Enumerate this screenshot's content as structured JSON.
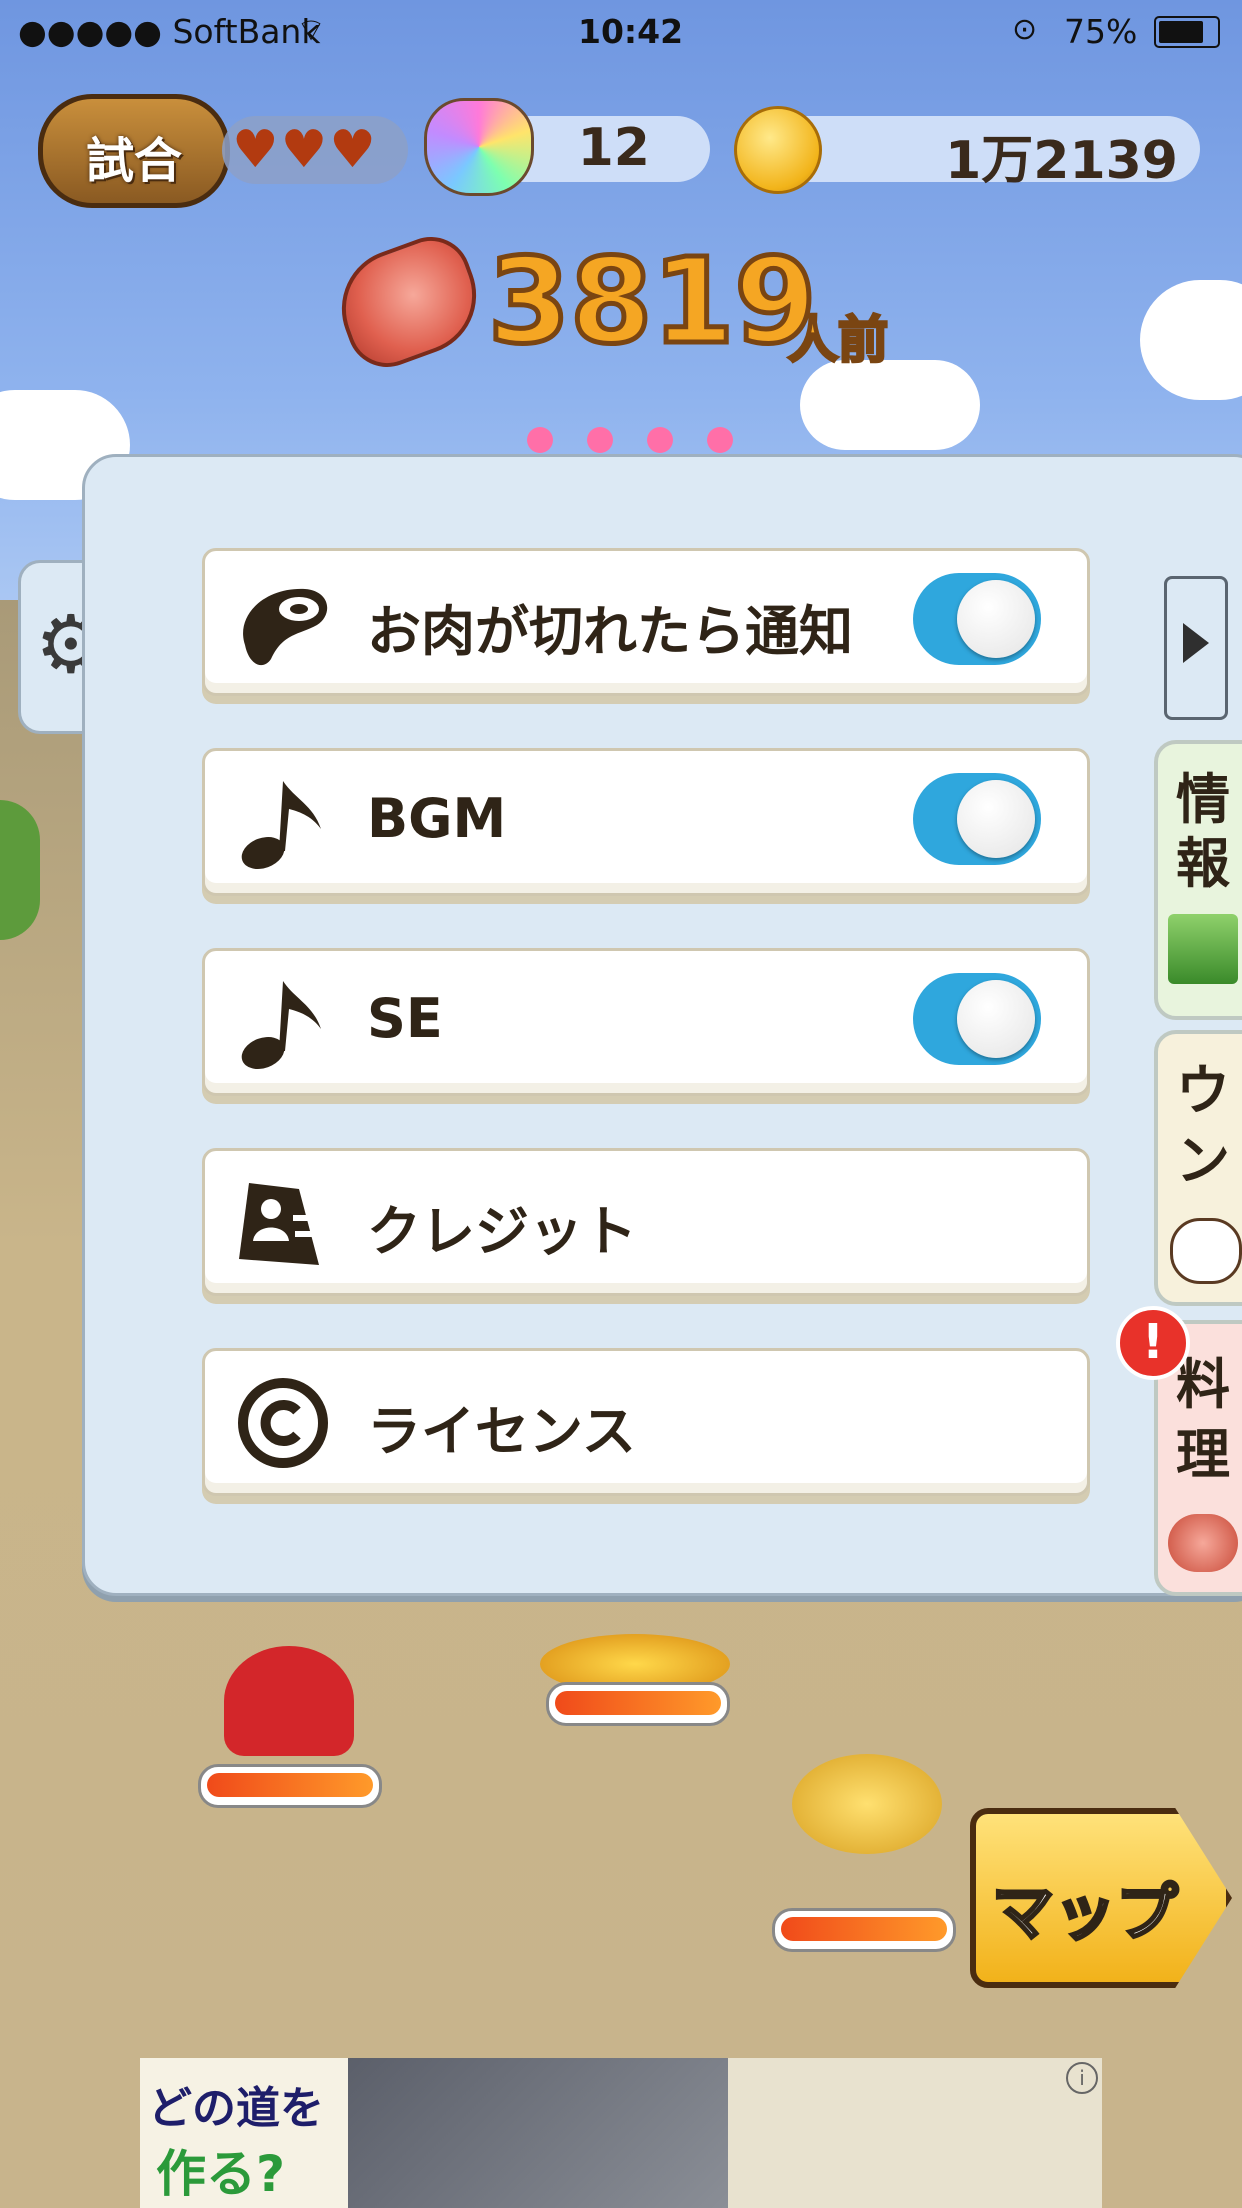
{
  "status_bar": {
    "carrier": "●●●●● SoftBank",
    "time": "10:42",
    "battery": "75%"
  },
  "hud": {
    "match_button": "試合",
    "hearts": "♥♥♥",
    "cow_tickets": "12",
    "coins": "1万2139",
    "meat_count": "3819",
    "meat_unit": "人前"
  },
  "settings": {
    "rows": [
      {
        "label": "お肉が切れたら通知",
        "icon": "meat-icon",
        "toggle": true
      },
      {
        "label": "BGM",
        "icon": "music-note-icon",
        "toggle": true
      },
      {
        "label": "SE",
        "icon": "music-note-icon",
        "toggle": true
      },
      {
        "label": "クレジット",
        "icon": "id-card-icon"
      },
      {
        "label": "ライセンス",
        "icon": "copyright-icon"
      }
    ]
  },
  "side_tabs": {
    "info": "情報",
    "unko": "ウン",
    "cooking": "料理"
  },
  "map_button": "マップ",
  "ad_banner": {
    "text_line1": "どの道を",
    "text_line2": "作る?"
  },
  "colors": {
    "toggle_on": "#2fa7dd",
    "panel_bg": "#dce9f4",
    "meat_number": "#f5a623"
  }
}
